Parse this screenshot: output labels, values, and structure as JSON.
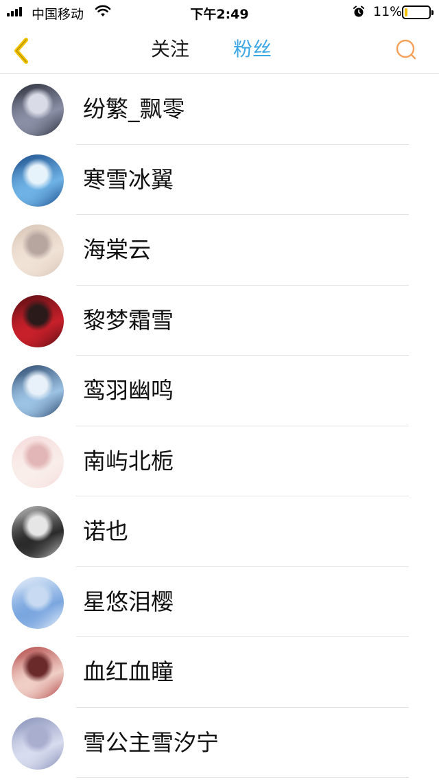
{
  "status_bar": {
    "carrier": "中国移动",
    "time": "下午2:49",
    "battery_percent": "11%",
    "battery_level": 0.11,
    "icons": [
      "signal-icon",
      "wifi-icon",
      "alarm-icon",
      "battery-icon"
    ]
  },
  "nav": {
    "back_icon": "chevron-left-icon",
    "tabs": [
      {
        "label": "关注",
        "active": false
      },
      {
        "label": "粉丝",
        "active": true
      }
    ],
    "search_icon": "search-icon",
    "active_color": "#3aa6e3",
    "back_color": "#f2c200",
    "search_color": "#f4a05a"
  },
  "fans": [
    {
      "name": "纷繁_飘零",
      "avatar_colors": [
        "#2b2f3a",
        "#8a8fa6",
        "#d9dbe6"
      ]
    },
    {
      "name": "寒雪冰翼",
      "avatar_colors": [
        "#1d4f8c",
        "#6fb3e6",
        "#e6f3fb"
      ]
    },
    {
      "name": "海棠云",
      "avatar_colors": [
        "#d8c7b8",
        "#f1e2d6",
        "#b7a6a0"
      ]
    },
    {
      "name": "黎梦霜雪",
      "avatar_colors": [
        "#5a0f14",
        "#c8202a",
        "#2a1a1a"
      ]
    },
    {
      "name": "鸾羽幽鸣",
      "avatar_colors": [
        "#2d4a6d",
        "#9cc2e4",
        "#e8f1f9"
      ]
    },
    {
      "name": "南屿北栀",
      "avatar_colors": [
        "#f6dcdc",
        "#f9eeea",
        "#e2b6b6"
      ]
    },
    {
      "name": "诺也",
      "avatar_colors": [
        "#b9b9b9",
        "#2a2a2a",
        "#e6e6e6"
      ]
    },
    {
      "name": "星悠泪樱",
      "avatar_colors": [
        "#e9f1fb",
        "#7aa6df",
        "#c7daf1"
      ]
    },
    {
      "name": "血红血瞳",
      "avatar_colors": [
        "#b34a4a",
        "#f0cfc6",
        "#6b2a2a"
      ]
    },
    {
      "name": "雪公主雪汐宁",
      "avatar_colors": [
        "#8791b8",
        "#d8dcef",
        "#a9aecf"
      ]
    }
  ]
}
